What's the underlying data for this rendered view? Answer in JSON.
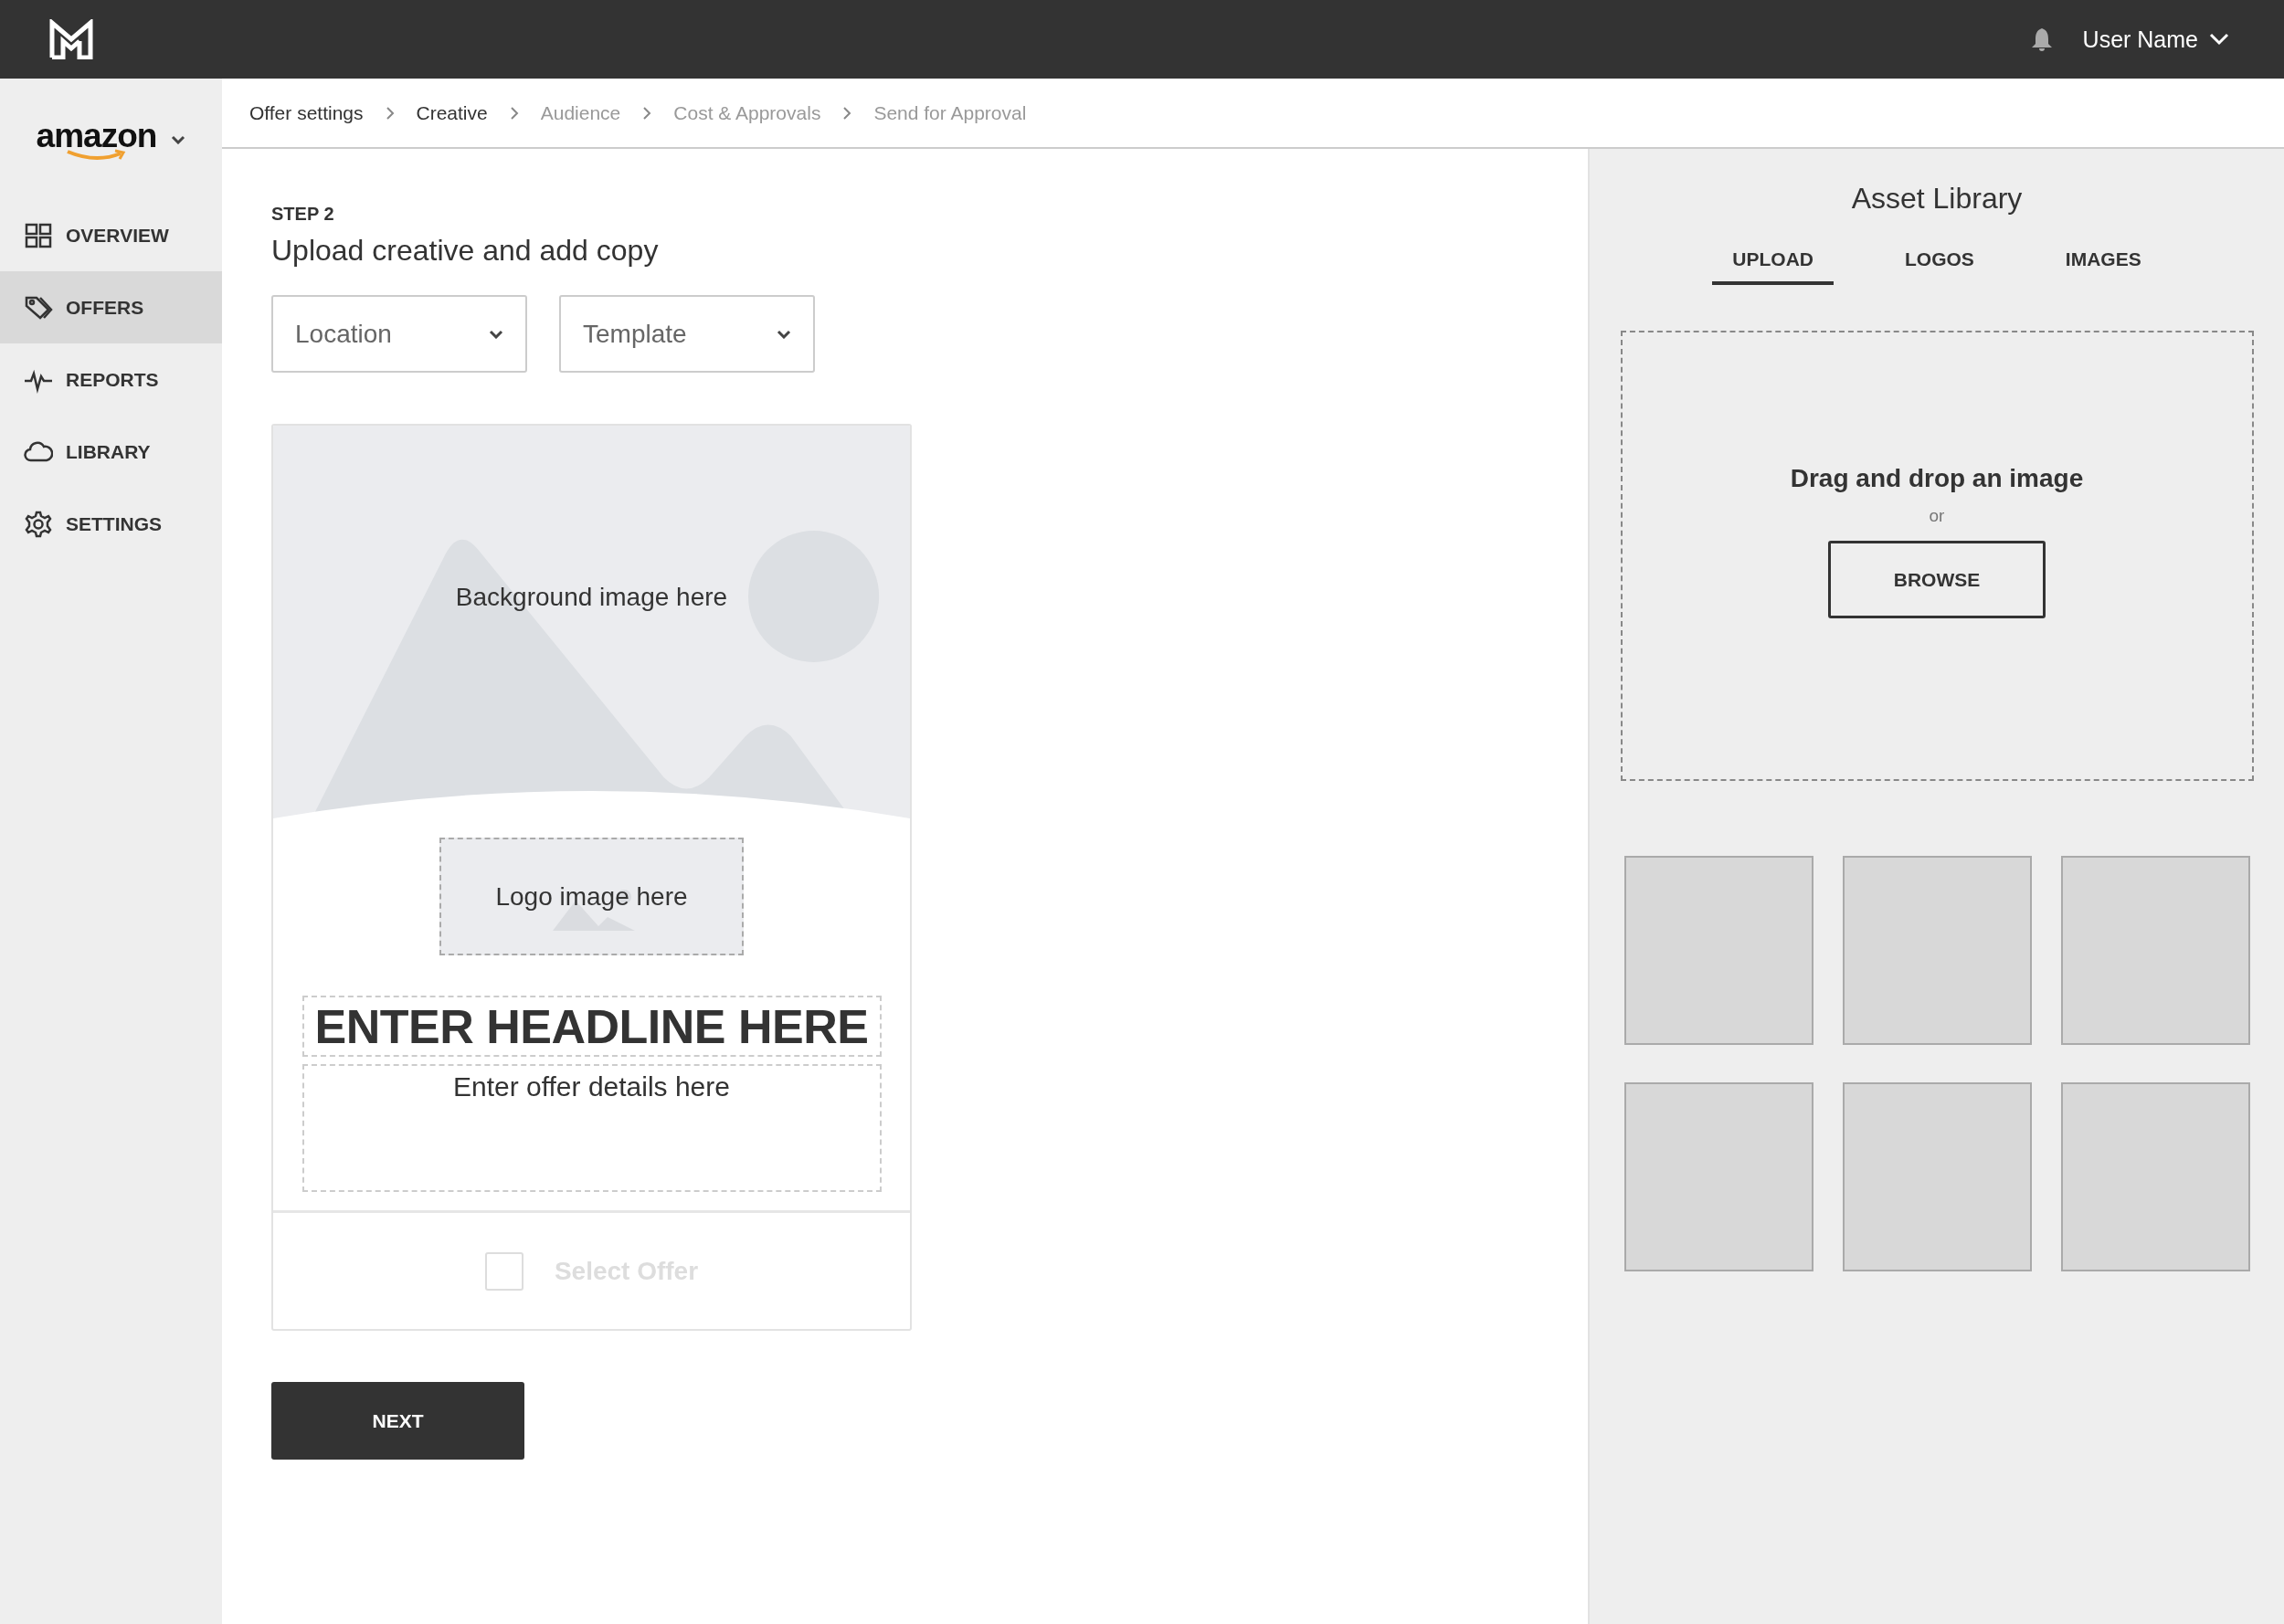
{
  "top_bar": {
    "user_name": "User Name"
  },
  "account": {
    "brand": "amazon"
  },
  "sidebar": {
    "items": [
      {
        "label": "OVERVIEW",
        "selected": false
      },
      {
        "label": "OFFERS",
        "selected": true
      },
      {
        "label": "REPORTS",
        "selected": false
      },
      {
        "label": "LIBRARY",
        "selected": false
      },
      {
        "label": "SETTINGS",
        "selected": false
      }
    ]
  },
  "breadcrumb": [
    {
      "label": "Offer settings",
      "reached": true
    },
    {
      "label": "Creative",
      "reached": true
    },
    {
      "label": "Audience",
      "reached": false
    },
    {
      "label": "Cost & Approvals",
      "reached": false
    },
    {
      "label": "Send for Approval",
      "reached": false
    }
  ],
  "step": {
    "label": "STEP 2",
    "title": "Upload creative and add copy"
  },
  "dropdowns": [
    {
      "placeholder": "Location"
    },
    {
      "placeholder": "Template"
    }
  ],
  "offer_card": {
    "background_hint": "Background image here",
    "logo_hint": "Logo image here",
    "headline": "ENTER HEADLINE HERE",
    "details": "Enter offer details here",
    "select": {
      "label": "Select Offer",
      "checked": false,
      "disabled": true
    }
  },
  "next_button": "NEXT",
  "asset_library": {
    "title": "Asset Library",
    "tabs": [
      {
        "label": "UPLOAD",
        "selected": true
      },
      {
        "label": "LOGOS",
        "selected": false
      },
      {
        "label": "IMAGES",
        "selected": false
      }
    ],
    "drop_zone": {
      "title": "Drag and drop an image",
      "or": "or",
      "button": "BROWSE"
    },
    "tiles": [
      {
        "kind": "empty"
      },
      {
        "kind": "empty"
      },
      {
        "kind": "empty"
      },
      {
        "kind": "empty"
      },
      {
        "kind": "empty"
      },
      {
        "kind": "empty"
      }
    ]
  }
}
